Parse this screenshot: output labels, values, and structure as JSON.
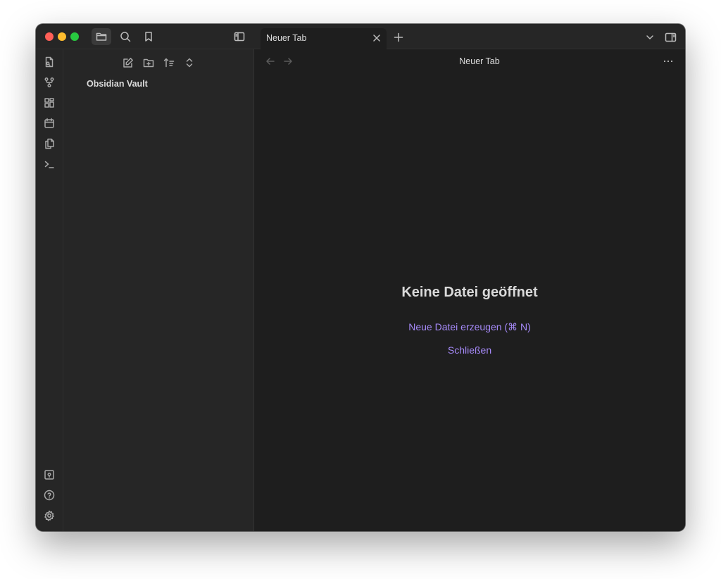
{
  "titlebar": {
    "tab_title": "Neuer Tab"
  },
  "sidebar": {
    "vault_name": "Obsidian Vault"
  },
  "main": {
    "view_title": "Neuer Tab",
    "empty_title": "Keine Datei geöffnet",
    "actions": {
      "new_file": "Neue Datei erzeugen (⌘ N)",
      "close": "Schließen"
    }
  },
  "colors": {
    "accent": "#a68af9",
    "background": "#1e1e1e",
    "sidebar": "#262626"
  }
}
